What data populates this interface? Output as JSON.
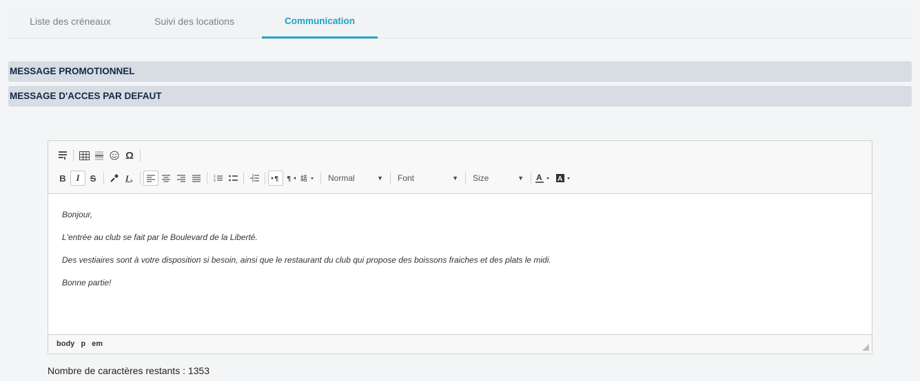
{
  "tabs": [
    {
      "label": "Liste des créneaux"
    },
    {
      "label": "Suivi des locations"
    },
    {
      "label": "Communication"
    }
  ],
  "accordion": [
    {
      "title": "MESSAGE PROMOTIONNEL"
    },
    {
      "title": "MESSAGE D'ACCES PAR DEFAUT"
    }
  ],
  "toolbar": {
    "row1_icons": [
      "source-icon",
      "table-icon",
      "horizontal-line-icon",
      "smiley-icon",
      "special-char-icon"
    ],
    "bold": "B",
    "italic": "I",
    "strike": "S",
    "omega": "Ω",
    "format_combo": "Normal",
    "font_combo": "Font",
    "size_combo": "Size"
  },
  "content": {
    "paragraphs": [
      "Bonjour,",
      "L'entrée au club se fait par le Boulevard de la Liberté.",
      "Des vestiaires sont à votre disposition si besoin, ainsi que le restaurant du club qui propose des boissons fraiches et des plats le midi.",
      "Bonne partie!"
    ]
  },
  "pathbar": [
    "body",
    "p",
    "em"
  ],
  "counter": "Nombre de caractères restants : 1353"
}
